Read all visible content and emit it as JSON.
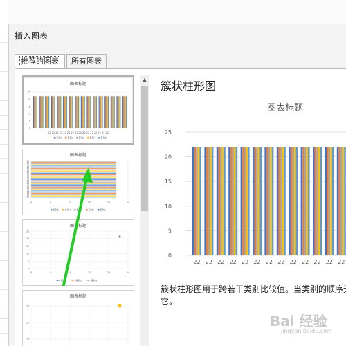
{
  "dialog": {
    "title": "插入图表",
    "tabs": [
      {
        "label": "推荐的图表",
        "active": true
      },
      {
        "label": "所有图表",
        "active": false
      }
    ]
  },
  "thumbnails": [
    {
      "title": "图表标题",
      "kind": "clustered-column",
      "selected": true,
      "y_ticks": [
        "25",
        "20",
        "15",
        "10",
        "5",
        "0"
      ],
      "x_label": "22 22 22 22 22 22 22 22 22 22 22 22 22 22 22 22",
      "legend": [
        "系列1",
        "系列2",
        "系列3",
        "系列4",
        "系列5"
      ]
    },
    {
      "title": "图表标题",
      "kind": "clustered-bar",
      "selected": false,
      "x_ticks": [
        "0",
        "5",
        "10",
        "15",
        "20",
        "25"
      ],
      "legend": [
        "系列5",
        "系列4",
        "系列3",
        "系列2",
        "系列1"
      ]
    },
    {
      "title": "图表标题",
      "kind": "line",
      "selected": false,
      "y_ticks": [
        "25",
        "20",
        "15",
        "10",
        "5",
        "0"
      ],
      "x_ticks": [
        "0",
        "5",
        "10",
        "15",
        "20",
        "25"
      ],
      "legend": [
        "系列1",
        "系列2",
        "系列3"
      ]
    },
    {
      "title": "图表标题",
      "kind": "scatter",
      "selected": false,
      "y_ticks": [
        "25",
        "20",
        "15"
      ]
    }
  ],
  "preview": {
    "chart_type_name": "簇状柱形图",
    "description_line1": "簇状柱形图用于跨若干类别比较值。当类别的顺序无",
    "description_line2": "它。"
  },
  "colors": {
    "series1": "#4472c4",
    "series2": "#ed7d31",
    "series3": "#a5a5a5",
    "series4": "#ffc000",
    "series5": "#5b9bd5",
    "arrow": "#22cc22"
  },
  "watermark": {
    "text": "Bai 经验",
    "sub": "jingyan.baidu.com"
  },
  "chart_data": {
    "type": "bar",
    "title": "图表标题",
    "categories": [
      "22",
      "22",
      "22",
      "22",
      "22",
      "22",
      "22",
      "22",
      "22",
      "22",
      "22",
      "22",
      "22",
      "22"
    ],
    "series": [
      {
        "name": "系列1",
        "values": [
          22,
          22,
          22,
          22,
          22,
          22,
          22,
          22,
          22,
          22,
          22,
          22,
          22,
          22
        ]
      },
      {
        "name": "系列2",
        "values": [
          22,
          22,
          22,
          22,
          22,
          22,
          22,
          22,
          22,
          22,
          22,
          22,
          22,
          22
        ]
      },
      {
        "name": "系列3",
        "values": [
          22,
          22,
          22,
          22,
          22,
          22,
          22,
          22,
          22,
          22,
          22,
          22,
          22,
          22
        ]
      },
      {
        "name": "系列4",
        "values": [
          22,
          22,
          22,
          22,
          22,
          22,
          22,
          22,
          22,
          22,
          22,
          22,
          22,
          22
        ]
      },
      {
        "name": "系列5",
        "values": [
          22,
          22,
          22,
          22,
          22,
          22,
          22,
          22,
          22,
          22,
          22,
          22,
          22,
          22
        ]
      }
    ],
    "ylim": [
      0,
      25
    ],
    "y_ticks": [
      25,
      20,
      15,
      10,
      5,
      0
    ],
    "grid": true,
    "legend": "bottom"
  }
}
